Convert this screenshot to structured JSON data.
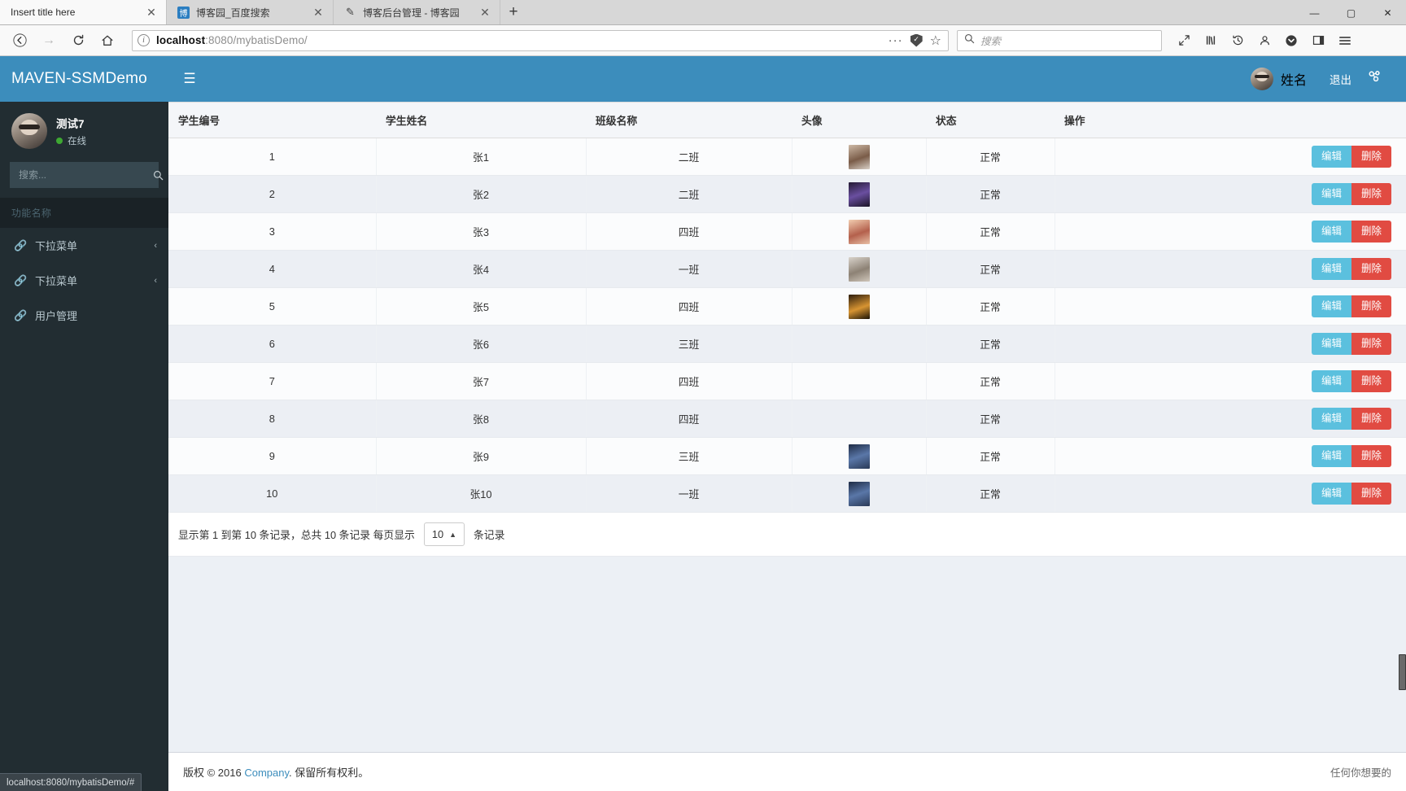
{
  "browser": {
    "tabs": [
      {
        "title": "Insert title here",
        "favicon": "",
        "active": true
      },
      {
        "title": "博客园_百度搜索",
        "favicon": "blog-favicon",
        "active": false
      },
      {
        "title": "博客后台管理 - 博客园",
        "favicon": "admin-favicon",
        "active": false
      }
    ],
    "new_tab_label": "+",
    "window_controls": {
      "minimize": "—",
      "maximize": "▢",
      "close": "✕"
    },
    "nav": {
      "back": "←",
      "forward": "→",
      "reload": "⟳",
      "home": "⌂"
    },
    "url": {
      "prefix": "localhost",
      "suffix": ":8080/mybatisDemo/",
      "info_icon": "ⓘ"
    },
    "url_actions": {
      "more": "···",
      "shield": "shield-icon",
      "bookmark": "☆"
    },
    "search": {
      "placeholder": "搜索",
      "icon": "search-icon"
    },
    "toolbar_icons": [
      "expand-icon",
      "library-icon",
      "history-icon",
      "account-icon",
      "pocket-icon",
      "sidebar-icon",
      "menu-icon"
    ],
    "status_bar": "localhost:8080/mybatisDemo/#"
  },
  "sidebar": {
    "brand": "MAVEN-SSMDemo",
    "user": {
      "name": "测试7",
      "status": "在线"
    },
    "search_placeholder": "搜索...",
    "section_header": "功能名称",
    "items": [
      {
        "label": "下拉菜单",
        "icon": "link-icon",
        "caret": "‹"
      },
      {
        "label": "下拉菜单",
        "icon": "link-icon",
        "caret": "‹"
      },
      {
        "label": "用户管理",
        "icon": "link-icon",
        "caret": ""
      }
    ]
  },
  "topnav": {
    "toggle": "☰",
    "user_name": "姓名",
    "logout": "退出",
    "gear": "settings-icon"
  },
  "table": {
    "columns": [
      "学生编号",
      "学生姓名",
      "班级名称",
      "头像",
      "状态",
      "操作"
    ],
    "rows": [
      {
        "id": "1",
        "name": "张1",
        "class": "二班",
        "avatar": "th1",
        "status": "正常"
      },
      {
        "id": "2",
        "name": "张2",
        "class": "二班",
        "avatar": "th2",
        "status": "正常"
      },
      {
        "id": "3",
        "name": "张3",
        "class": "四班",
        "avatar": "th3",
        "status": "正常"
      },
      {
        "id": "4",
        "name": "张4",
        "class": "一班",
        "avatar": "th4",
        "status": "正常"
      },
      {
        "id": "5",
        "name": "张5",
        "class": "四班",
        "avatar": "th5",
        "status": "正常"
      },
      {
        "id": "6",
        "name": "张6",
        "class": "三班",
        "avatar": "",
        "status": "正常"
      },
      {
        "id": "7",
        "name": "张7",
        "class": "四班",
        "avatar": "",
        "status": "正常"
      },
      {
        "id": "8",
        "name": "张8",
        "class": "四班",
        "avatar": "",
        "status": "正常"
      },
      {
        "id": "9",
        "name": "张9",
        "class": "三班",
        "avatar": "th9",
        "status": "正常"
      },
      {
        "id": "10",
        "name": "张10",
        "class": "一班",
        "avatar": "th10",
        "status": "正常"
      }
    ],
    "actions": {
      "edit": "编辑",
      "delete": "删除"
    }
  },
  "pagination": {
    "prefix": "显示第 1 到第 10 条记录，总共 10 条记录 每页显示",
    "page_size": "10",
    "caret": "▲",
    "suffix": "条记录"
  },
  "footer": {
    "copyright_prefix": "版权 © 2016",
    "company": "Company",
    "copyright_suffix": ". 保留所有权利。",
    "right": "任何你想要的"
  },
  "colors": {
    "brand_blue": "#3c8dbc",
    "sidebar_dark": "#222d32",
    "edit_blue": "#5bc0de",
    "delete_red": "#e14b42",
    "online_green": "#3ea832",
    "page_bg": "#ecf0f5"
  }
}
